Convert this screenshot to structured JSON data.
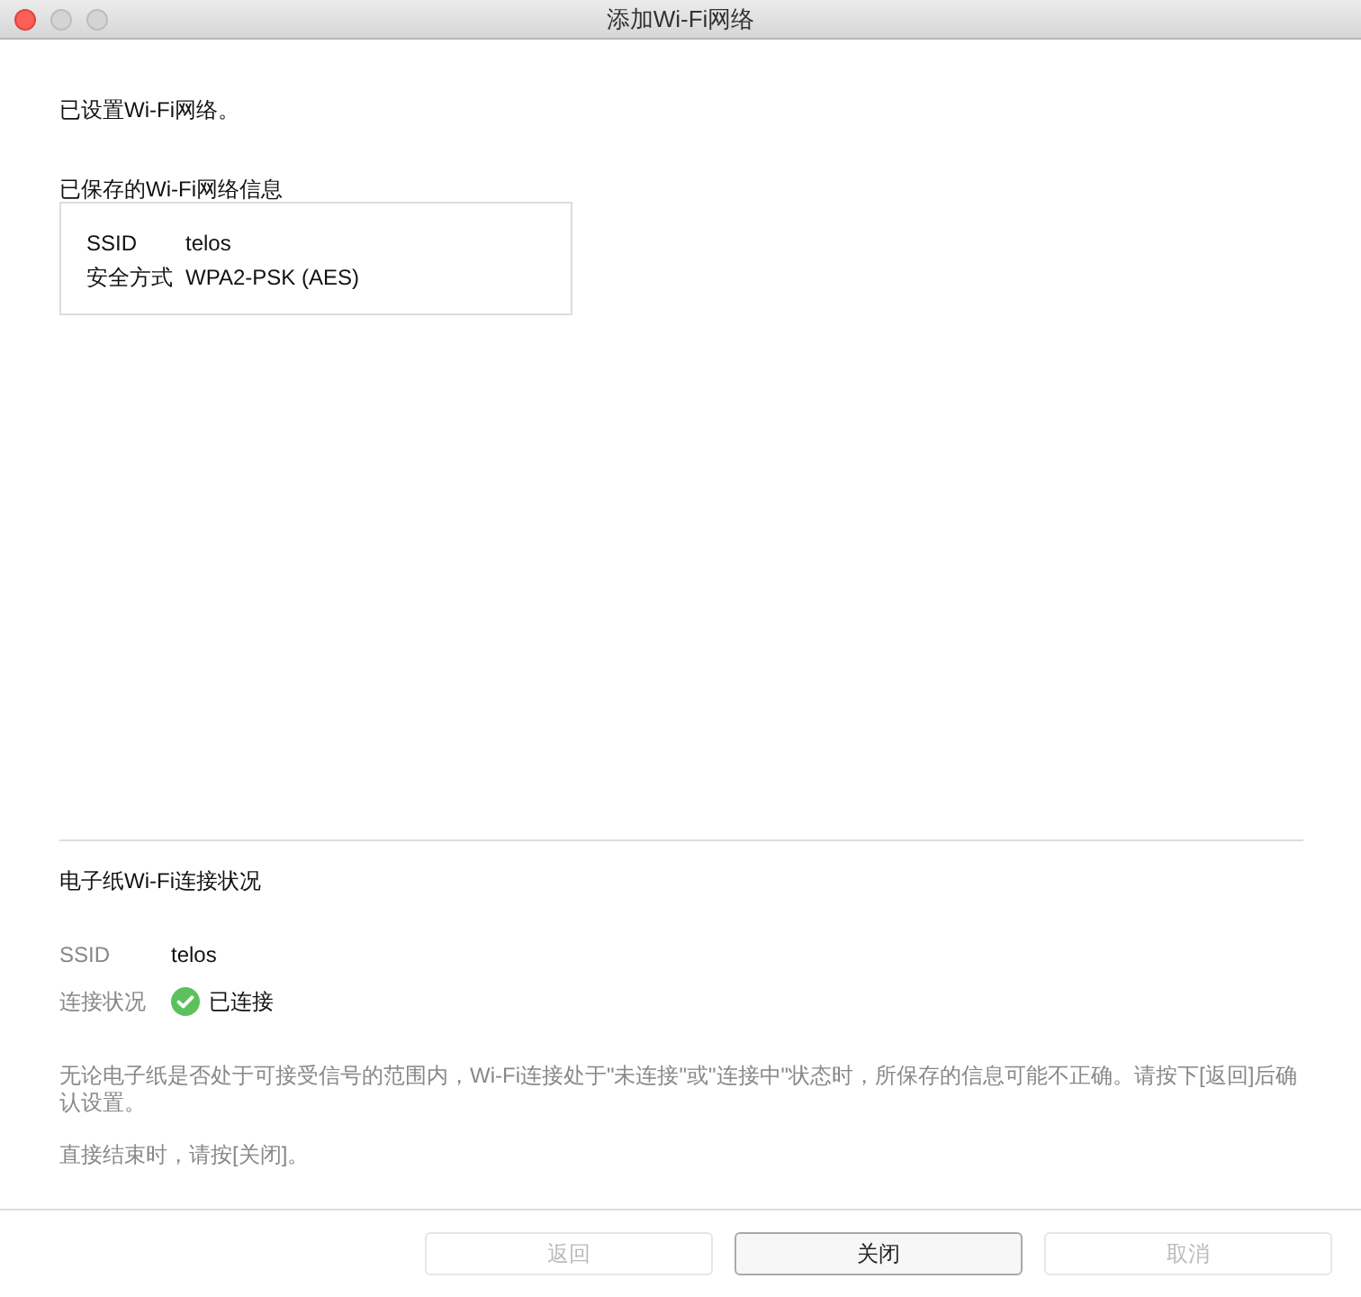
{
  "window": {
    "title": "添加Wi-Fi网络"
  },
  "message": "已设置Wi-Fi网络。",
  "saved_info": {
    "heading": "已保存的Wi-Fi网络信息",
    "fields": [
      {
        "label": "SSID",
        "value": "telos"
      },
      {
        "label": "安全方式",
        "value": "WPA2-PSK (AES)"
      }
    ]
  },
  "connection": {
    "heading": "电子纸Wi-Fi连接状况",
    "ssid_label": "SSID",
    "ssid": "telos",
    "status_label": "连接状况",
    "status": "已连接",
    "connected": true
  },
  "notes": [
    "无论电子纸是否处于可接受信号的范围内，Wi-Fi连接处于\"未连接\"或\"连接中\"状态时，所保存的信息可能不正确。请按下[返回]后确认设置。",
    "直接结束时，请按[关闭]。"
  ],
  "buttons": [
    {
      "label": "返回",
      "disabled": true
    },
    {
      "label": "关闭",
      "disabled": false
    },
    {
      "label": "取消",
      "disabled": true
    }
  ]
}
